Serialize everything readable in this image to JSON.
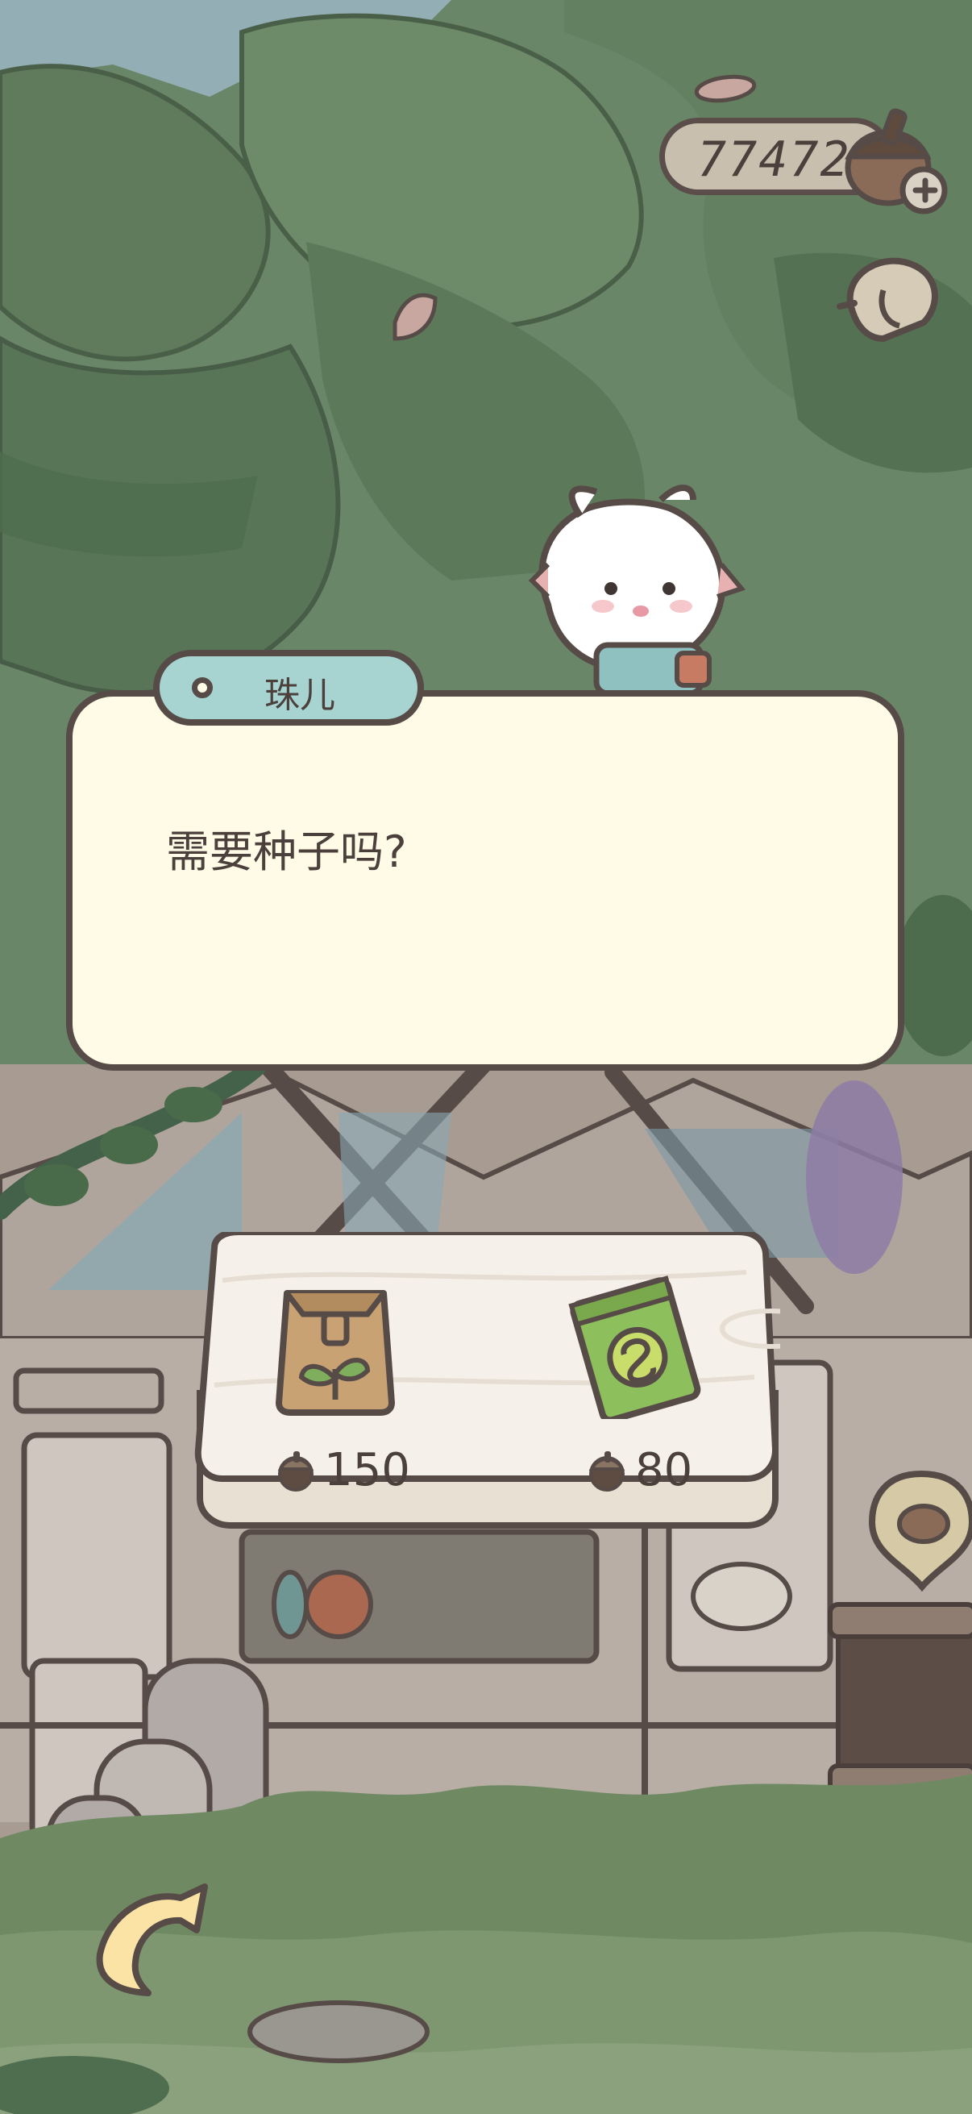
{
  "hud": {
    "acorn_count": "77472",
    "add_icon": "plus-icon",
    "hat_icon": "hat-icon"
  },
  "dialog": {
    "speaker": "珠儿",
    "text": "需要种子吗?"
  },
  "shop": {
    "items": [
      {
        "name": "seed-bag",
        "icon": "seed-bag-icon",
        "price": "150"
      },
      {
        "name": "seed-packet",
        "icon": "seed-packet-icon",
        "price": "80"
      }
    ],
    "currency_icon": "acorn-icon"
  },
  "colors": {
    "outline": "#574b48",
    "dialog_bg": "#fffbe6",
    "name_tag": "#a7d3d0",
    "forest_dark": "#4f6e53",
    "forest_light": "#6b8566"
  }
}
